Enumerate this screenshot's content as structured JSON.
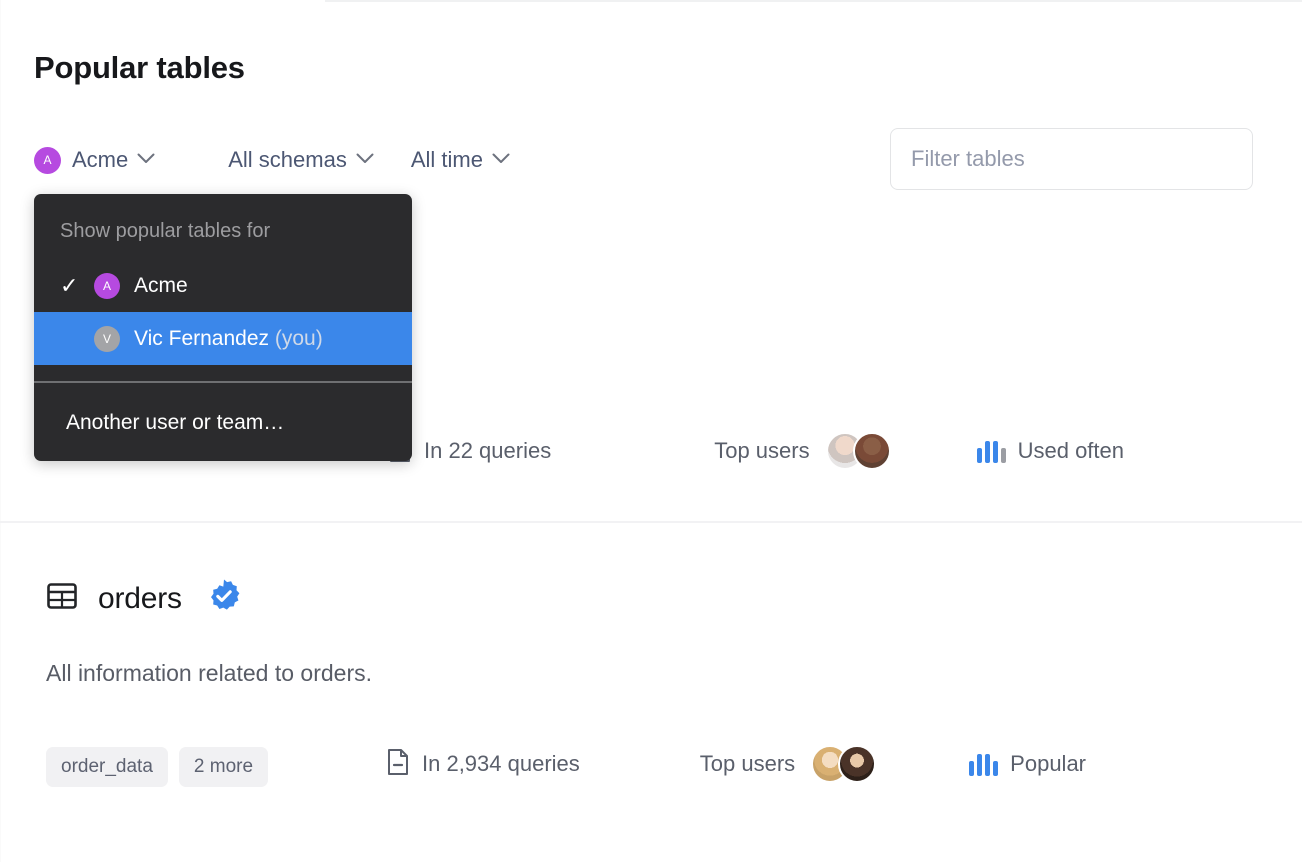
{
  "header": {
    "title": "Popular tables"
  },
  "filters": {
    "entity": {
      "avatar_initial": "A",
      "avatar_color": "#b64ae0",
      "label": "Acme",
      "chevron": "chevron-down-icon"
    },
    "schema": {
      "label": "All schemas",
      "chevron": "chevron-down-icon"
    },
    "time": {
      "label": "All time",
      "chevron": "chevron-down-icon"
    },
    "search": {
      "value": "",
      "placeholder": "Filter tables"
    }
  },
  "dropdown": {
    "heading": "Show popular tables for",
    "items": [
      {
        "label": "Acme",
        "suffix": "",
        "avatar_initial": "A",
        "avatar_color": "#b64ae0",
        "checked": true,
        "highlighted": false
      },
      {
        "label": "Vic Fernandez",
        "suffix": " (you)",
        "avatar_initial": "V",
        "avatar_color": "#a3a4a7",
        "checked": false,
        "highlighted": true
      }
    ],
    "footer_label": "Another user or team…",
    "highlight_color": "#3b87ea",
    "background_color": "#2b2b2d"
  },
  "tables": [
    {
      "name": "",
      "description": "",
      "chips": [],
      "query_icon": "document-icon",
      "query_count_label": "In 22 queries",
      "top_users_label": "Top users",
      "top_users_count": 2,
      "usage_icon": "bar-chart-icon",
      "usage_label": "Used often",
      "usage_bars": [
        "blue",
        "blue",
        "blue",
        "gray"
      ]
    },
    {
      "name": "orders",
      "table_icon": "table-icon",
      "verified_icon": "verified-badge-icon",
      "description": "All information related to orders.",
      "chips": [
        "order_data",
        "2 more"
      ],
      "query_icon": "document-icon",
      "query_count_label": "In 2,934 queries",
      "top_users_label": "Top users",
      "top_users_count": 2,
      "usage_icon": "bar-chart-icon",
      "usage_label": "Popular",
      "usage_bars": [
        "blue",
        "blue",
        "blue",
        "blue"
      ]
    }
  ],
  "colors": {
    "accent_blue": "#3b87ea",
    "purple": "#b64ae0",
    "text_primary": "#17181b",
    "text_secondary": "#5a5f6b"
  }
}
